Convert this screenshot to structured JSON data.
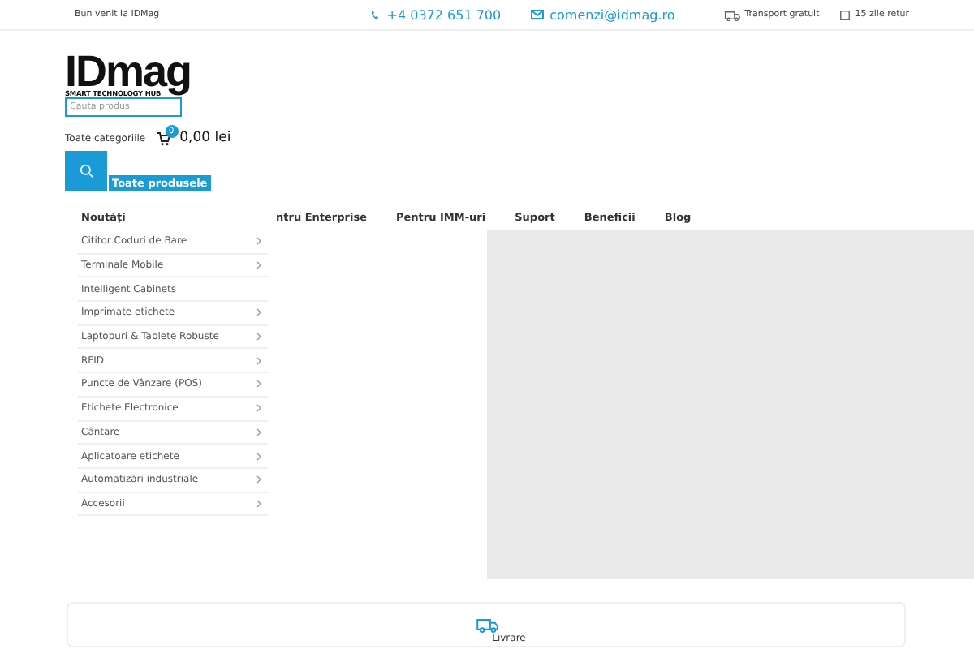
{
  "top_bar": {
    "welcome": "Bun venit la IDMag",
    "phone": "+4 0372 651 700",
    "email": "comenzi@idmag.ro",
    "perks": [
      {
        "kind": "truck",
        "label": "Transport gratuit"
      },
      {
        "kind": "return",
        "label": "15 zile retur"
      }
    ]
  },
  "header": {
    "logo": "IDmag",
    "tagline": "SMART TECHNOLOGY HUB",
    "search": {
      "placeholder": "Cauta produs"
    },
    "category_select": "Toate categoriile",
    "cart": {
      "count": "0",
      "total": "0,00 lei"
    },
    "all_products": "Toate produsele"
  },
  "nav": {
    "items": [
      "Noutăți",
      "ntru Enterprise",
      "Pentru IMM-uri",
      "Suport",
      "Beneficii",
      "Blog"
    ]
  },
  "categories": [
    {
      "label": "Cititor Coduri de Bare",
      "has_children": true
    },
    {
      "label": "Terminale Mobile",
      "has_children": true
    },
    {
      "label": "Intelligent Cabinets",
      "has_children": false
    },
    {
      "label": "Imprimate etichete",
      "has_children": true
    },
    {
      "label": "Laptopuri & Tablete Robuste",
      "has_children": true
    },
    {
      "label": "RFID",
      "has_children": true
    },
    {
      "label": "Puncte de Vânzare (POS)",
      "has_children": true
    },
    {
      "label": "Etichete Electronice",
      "has_children": true
    },
    {
      "label": "Cântare",
      "has_children": true
    },
    {
      "label": "Aplicatoare etichete",
      "has_children": true
    },
    {
      "label": "Automatizări industriale",
      "has_children": true
    },
    {
      "label": "Accesorii",
      "has_children": true
    }
  ],
  "features": [
    {
      "label": "Livrare"
    }
  ]
}
